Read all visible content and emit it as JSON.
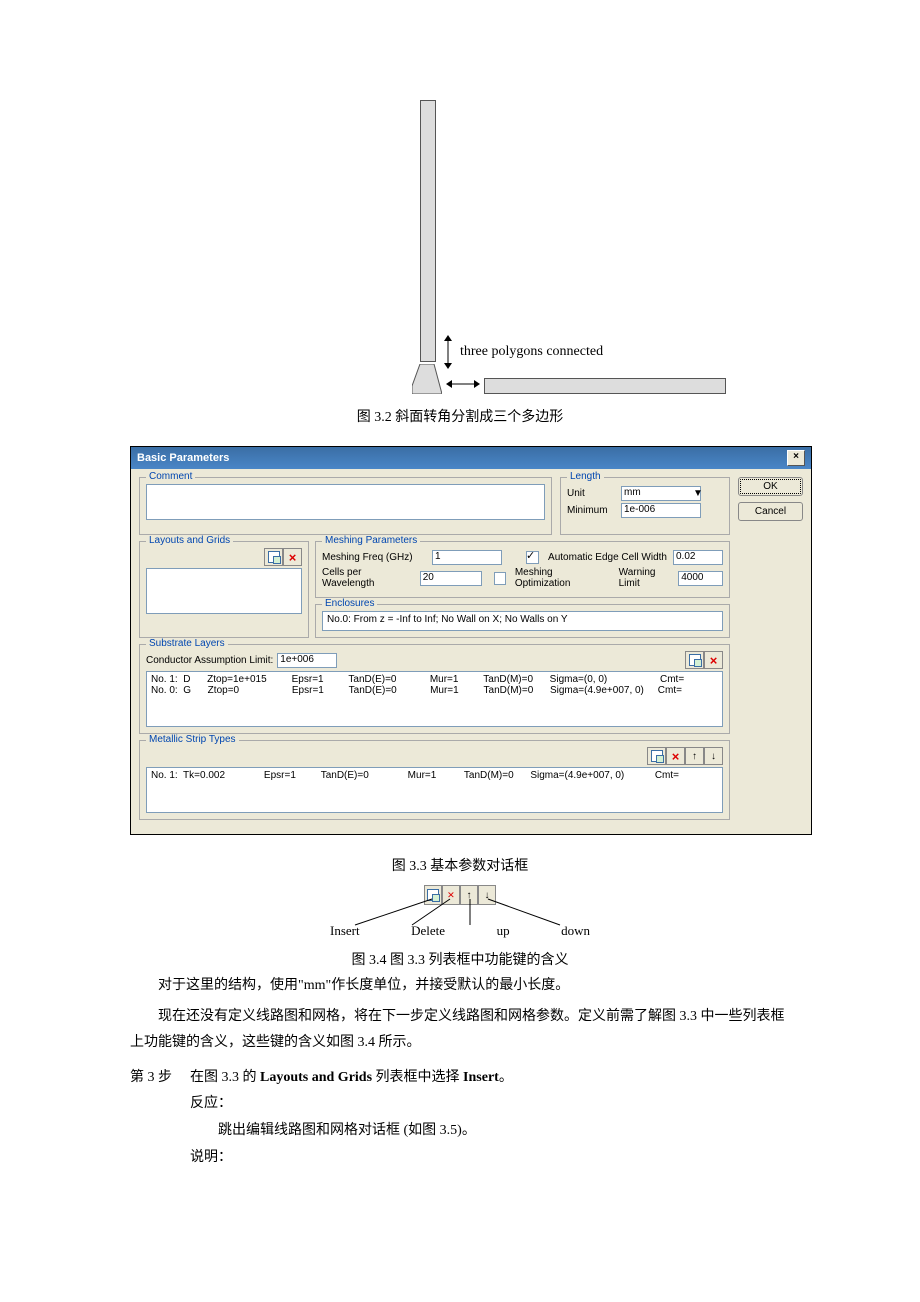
{
  "fig1": {
    "annot": "three polygons connected",
    "caption": "图 3.2 斜面转角分割成三个多边形"
  },
  "dlg": {
    "title": "Basic Parameters",
    "comment_label": "Comment",
    "length": {
      "label": "Length",
      "unit_label": "Unit",
      "unit": "mm",
      "min_label": "Minimum",
      "min": "1e-006"
    },
    "buttons": {
      "ok": "OK",
      "cancel": "Cancel"
    },
    "layouts_label": "Layouts and Grids",
    "meshing": {
      "label": "Meshing Parameters",
      "freq_label": "Meshing Freq (GHz)",
      "freq": "1",
      "cpw_label": "Cells per Wavelength",
      "cpw": "20",
      "auto_label": "Automatic Edge Cell Width",
      "auto_val": "0.02",
      "opt_label": "Meshing Optimization",
      "warn_label": "Warning Limit",
      "warn_val": "4000"
    },
    "enclosures": {
      "label": "Enclosures",
      "item": "No.0: From z = -Inf to Inf; No Wall on X; No Walls on Y"
    },
    "substrate": {
      "label": "Substrate Layers",
      "cal_label": "Conductor Assumption Limit:",
      "cal_val": "1e+006",
      "row1": "No. 1:  D      Ztop=1e+015         Epsr=1         TanD(E)=0            Mur=1         TanD(M)=0      Sigma=(0, 0)                   Cmt=",
      "row0": "No. 0:  G      Ztop=0                   Epsr=1         TanD(E)=0            Mur=1         TanD(M)=0      Sigma=(4.9e+007, 0)     Cmt="
    },
    "metallic": {
      "label": "Metallic Strip Types",
      "row": "No. 1:  Tk=0.002              Epsr=1         TanD(E)=0              Mur=1          TanD(M)=0      Sigma=(4.9e+007, 0)           Cmt="
    }
  },
  "caption33": "图 3.3  基本参数对话框",
  "fig34": {
    "insert": "Insert",
    "delete": "Delete",
    "up": "up",
    "down": "down",
    "caption": "图 3.4 图 3.3 列表框中功能键的含义"
  },
  "p1": "对于这里的结构，使用\"mm\"作长度单位，并接受默认的最小长度。",
  "p2": "现在还没有定义线路图和网格，将在下一步定义线路图和网格参数。定义前需了解图 3.3 中一些列表框上功能键的含义，这些键的含义如图 3.4 所示。",
  "step3": {
    "label": "第 3 步",
    "line1a": "在图 3.3 的 ",
    "line1b": "Layouts and Grids",
    "line1c": " 列表框中选择 ",
    "line1d": "Insert",
    "line1e": "。",
    "react": "反应：",
    "react_body": "跳出编辑线路图和网格对话框 (如图 3.5)。",
    "explain": "说明："
  }
}
